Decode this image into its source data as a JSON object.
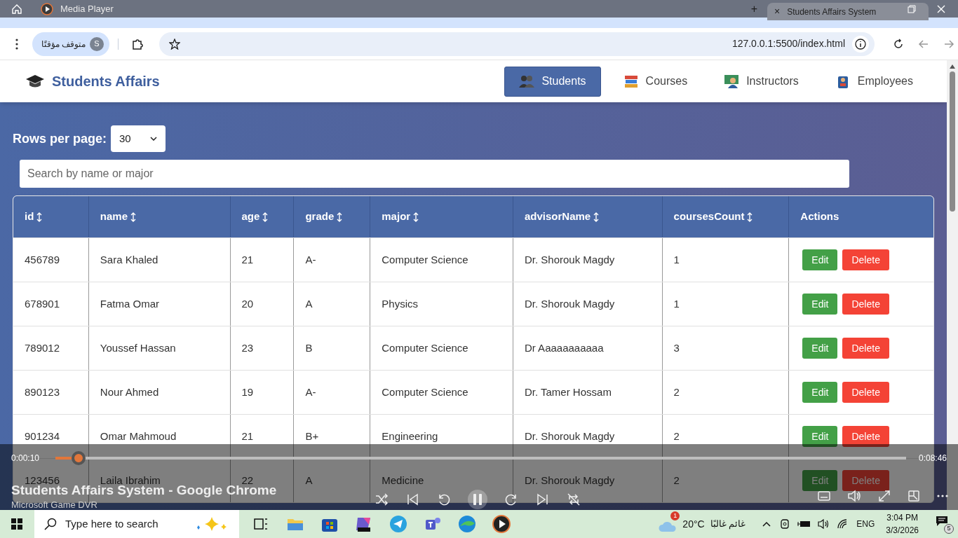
{
  "browser": {
    "media_tab": "Media Player",
    "new_tab": "+",
    "tab_close": "×",
    "tab_title": "Students Affairs System",
    "profile_status": "متوقف مؤقتًا",
    "profile_initial": "S",
    "url": "127.0.0.1:5500/index.html"
  },
  "app": {
    "brand": "Students Affairs",
    "nav": [
      {
        "label": "Students",
        "selected": true,
        "kind": "students"
      },
      {
        "label": "Courses",
        "selected": false,
        "kind": "courses"
      },
      {
        "label": "Instructors",
        "selected": false,
        "kind": "instructors"
      },
      {
        "label": "Employees",
        "selected": false,
        "kind": "employees"
      }
    ],
    "rows_per_page_label": "Rows per page:",
    "rows_per_page": "30",
    "search_placeholder": "Search by name or major"
  },
  "table": {
    "columns": [
      {
        "label": "id",
        "sortable": true
      },
      {
        "label": "name",
        "sortable": true
      },
      {
        "label": "age",
        "sortable": true
      },
      {
        "label": "grade",
        "sortable": true
      },
      {
        "label": "major",
        "sortable": true
      },
      {
        "label": "advisorName",
        "sortable": true
      },
      {
        "label": "coursesCount",
        "sortable": true
      },
      {
        "label": "Actions",
        "sortable": false
      }
    ],
    "rows": [
      {
        "cells": [
          "456789",
          "Sara Khaled",
          "21",
          "A-",
          "Computer Science",
          "Dr. Shorouk Magdy",
          "1"
        ],
        "actions": [
          "Edit",
          "Delete"
        ]
      },
      {
        "cells": [
          "678901",
          "Fatma Omar",
          "20",
          "A",
          "Physics",
          "Dr. Shorouk Magdy",
          "1"
        ],
        "actions": [
          "Edit",
          "Delete"
        ]
      },
      {
        "cells": [
          "789012",
          "Youssef Hassan",
          "23",
          "B",
          "Computer Science",
          "Dr Aaaaaaaaaaa",
          "3"
        ],
        "actions": [
          "Edit",
          "Delete"
        ]
      },
      {
        "cells": [
          "890123",
          "Nour Ahmed",
          "19",
          "A-",
          "Computer Science",
          "Dr. Tamer Hossam",
          "2"
        ],
        "actions": [
          "Edit",
          "Delete"
        ]
      },
      {
        "cells": [
          "901234",
          "Omar Mahmoud",
          "21",
          "B+",
          "Engineering",
          "Dr. Shorouk Magdy",
          "2"
        ],
        "actions": [
          "Edit",
          "Delete"
        ]
      },
      {
        "cells": [
          "123456",
          "Laila Ibrahim",
          "22",
          "A",
          "Medicine",
          "Dr. Shorouk Magdy",
          "2"
        ],
        "actions": [
          "Edit",
          "Delete"
        ]
      }
    ]
  },
  "player": {
    "elapsed": "0:00:10",
    "duration": "0:08:46",
    "level": 0.027,
    "title": "Students Affairs System - Google Chrome",
    "subtitle": "Microsoft Game DVR"
  },
  "taskbar": {
    "search_placeholder": "Type here to search",
    "weather_badge": "1",
    "temperature": "20°C",
    "weather_text": "غائم غالبًا",
    "language": "ENG",
    "time": "3:04 PM",
    "date": "3/3/2026",
    "notifications": "5"
  }
}
